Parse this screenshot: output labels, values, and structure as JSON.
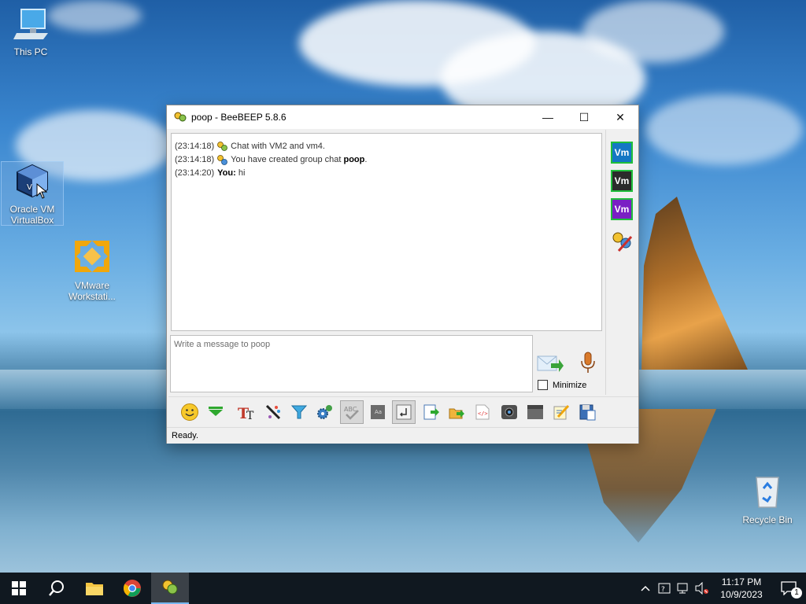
{
  "desktop": {
    "icons": [
      {
        "label": "This PC"
      },
      {
        "label": "Oracle VM VirtualBox"
      },
      {
        "label": "VMware Workstati..."
      },
      {
        "label": "Recycle Bin"
      }
    ]
  },
  "window": {
    "title": "poop - BeeBEEP 5.8.6",
    "controls": {
      "minimize": "—",
      "maximize": "☐",
      "close": "✕"
    },
    "messages": [
      {
        "time": "(23:14:18)",
        "text": "Chat with VM2 and vm4.",
        "icon": "group-chat-icon"
      },
      {
        "time": "(23:14:18)",
        "text_prefix": "You have created group chat ",
        "text_bold": "poop",
        "text_suffix": ".",
        "icon": "create-group-icon"
      },
      {
        "time": "(23:14:20)",
        "sender": "You:",
        "text": " hi"
      }
    ],
    "compose_placeholder": "Write a message to poop",
    "minimize_label": "Minimize",
    "status": "Ready.",
    "side_users": [
      {
        "label": "Vm",
        "bg": "#1477c4"
      },
      {
        "label": "Vm",
        "bg": "#2b2b2b"
      },
      {
        "label": "Vm",
        "bg": "#7a1fc4"
      }
    ],
    "toolbar_icons": [
      "emoticon-icon",
      "green-arrow-icon",
      "font-icon",
      "color-icon",
      "filter-icon",
      "settings-icon",
      "spellcheck-icon",
      "word-complete-icon",
      "return-key-icon",
      "export-icon",
      "send-file-icon",
      "html-icon",
      "screenshot-icon",
      "clear-icon",
      "edit-icon",
      "save-icon"
    ]
  },
  "taskbar": {
    "time": "11:17 PM",
    "date": "10/9/2023",
    "notification_count": "1"
  },
  "colors": {
    "accent": "#1fbf3b",
    "taskbar": "#101820"
  }
}
